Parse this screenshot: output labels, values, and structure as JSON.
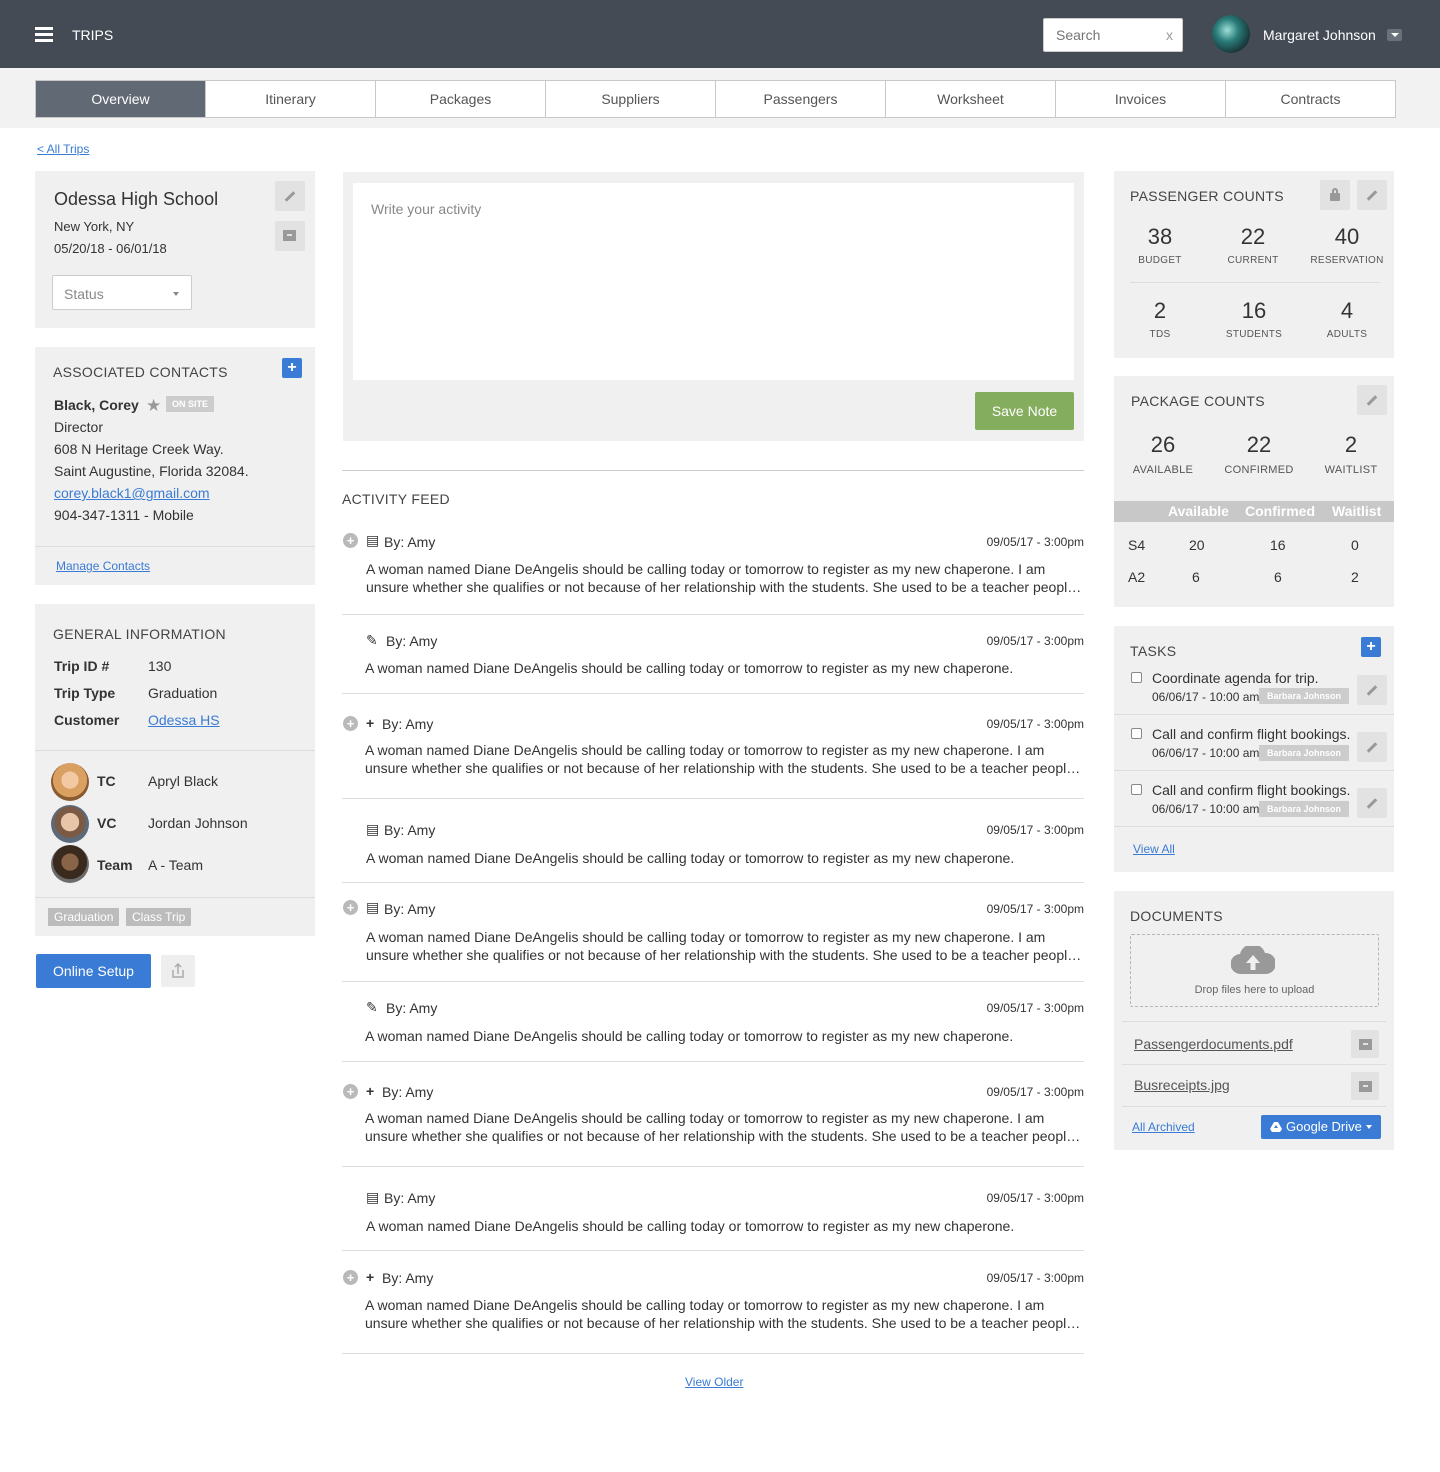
{
  "topbar": {
    "title": "TRIPS",
    "search_placeholder": "Search",
    "search_clear": "x",
    "user_name": "Margaret Johnson"
  },
  "tabs": [
    "Overview",
    "Itinerary",
    "Packages",
    "Suppliers",
    "Passengers",
    "Worksheet",
    "Invoices",
    "Contracts"
  ],
  "back_link": "< All Trips",
  "trip": {
    "name": "Odessa High School",
    "location": "New York, NY",
    "dates": "05/20/18 - 06/01/18",
    "status_placeholder": "Status"
  },
  "contacts": {
    "title": "ASSOCIATED CONTACTS",
    "add": "+",
    "name": "Black, Corey",
    "badge": "ON SITE",
    "role": "Director",
    "address1": "608 N Heritage Creek Way.",
    "address2": "Saint Augustine, Florida 32084.",
    "email": "corey.black1@gmail.com",
    "phone": "904-347-1311 - Mobile",
    "manage": "Manage Contacts"
  },
  "general": {
    "title": "GENERAL INFORMATION",
    "rows": [
      {
        "label": "Trip ID #",
        "value": "130"
      },
      {
        "label": "Trip Type",
        "value": "Graduation"
      },
      {
        "label": "Customer",
        "value": "Odessa HS"
      }
    ],
    "people": [
      {
        "role": "TC",
        "name": "Apryl Black"
      },
      {
        "role": "VC",
        "name": "Jordan Johnson"
      },
      {
        "role": "Team",
        "name": "A - Team"
      }
    ],
    "tags": [
      "Graduation",
      "Class Trip"
    ]
  },
  "online_setup": "Online Setup",
  "note": {
    "placeholder": "Write your activity",
    "save": "Save Note"
  },
  "feed": {
    "title": "ACTIVITY FEED",
    "items": [
      {
        "by": "By: Amy",
        "date": "09/05/17  -  3:00pm",
        "line1": "A woman named Diane DeAngelis should be calling today or tomorrow to register as my new chaperone. I am",
        "line2": "unsure whether she qualifies or not because of her relationship with the students. She used to be a teacher people at school"
      },
      {
        "by": "By: Amy",
        "date": "09/05/17  -  3:00pm",
        "line1": "A woman named Diane DeAngelis should be calling today or tomorrow to register as my new chaperone.",
        "line2": ""
      },
      {
        "by": "By: Amy",
        "date": "09/05/17  -  3:00pm",
        "line1": "A woman named Diane DeAngelis should be calling today or tomorrow to register as my new chaperone. I am",
        "line2": "unsure whether she qualifies or not because of her relationship with the students. She used to be a teacher people at school"
      },
      {
        "by": "By: Amy",
        "date": "09/05/17  -  3:00pm",
        "line1": "A woman named Diane DeAngelis should be calling today or tomorrow to register as my new chaperone.",
        "line2": ""
      },
      {
        "by": "By: Amy",
        "date": "09/05/17  -  3:00pm",
        "line1": "A woman named Diane DeAngelis should be calling today or tomorrow to register as my new chaperone. I am",
        "line2": "unsure whether she qualifies or not because of her relationship with the students. She used to be a teacher people at school"
      },
      {
        "by": "By: Amy",
        "date": "09/05/17  -  3:00pm",
        "line1": "A woman named Diane DeAngelis should be calling today or tomorrow to register as my new chaperone.",
        "line2": ""
      },
      {
        "by": "By: Amy",
        "date": "09/05/17  -  3:00pm",
        "line1": "A woman named Diane DeAngelis should be calling today or tomorrow to register as my new chaperone. I am",
        "line2": "unsure whether she qualifies or not because of her relationship with the students. She used to be a teacher people at school"
      },
      {
        "by": "By: Amy",
        "date": "09/05/17  -  3:00pm",
        "line1": "A woman named Diane DeAngelis should be calling today or tomorrow to register as my new chaperone.",
        "line2": ""
      },
      {
        "by": "By: Amy",
        "date": "09/05/17  -  3:00pm",
        "line1": "A woman named Diane DeAngelis should be calling today or tomorrow to register as my new chaperone. I am",
        "line2": "unsure whether she qualifies or not because of her relationship with the students. She used to be a teacher people at school"
      }
    ],
    "view_older": "View Older"
  },
  "passenger_counts": {
    "title": "PASSENGER COUNTS",
    "stats": [
      {
        "value": "38",
        "label": "BUDGET"
      },
      {
        "value": "22",
        "label": "CURRENT"
      },
      {
        "value": "40",
        "label": "RESERVATION"
      },
      {
        "value": "2",
        "label": "TDS"
      },
      {
        "value": "16",
        "label": "STUDENTS"
      },
      {
        "value": "4",
        "label": "ADULTS"
      }
    ]
  },
  "package_counts": {
    "title": "PACKAGE COUNTS",
    "stats": [
      {
        "value": "26",
        "label": "AVAILABLE"
      },
      {
        "value": "22",
        "label": "CONFIRMED"
      },
      {
        "value": "2",
        "label": "WAITLIST"
      }
    ],
    "headers": [
      "Available",
      "Confirmed",
      "Waitlist"
    ],
    "rows": [
      {
        "name": "S4",
        "available": "20",
        "confirmed": "16",
        "waitlist": "0"
      },
      {
        "name": "A2",
        "available": "6",
        "confirmed": "6",
        "waitlist": "2"
      }
    ]
  },
  "tasks": {
    "title": "TASKS",
    "add": "+",
    "items": [
      {
        "title": "Coordinate agenda for trip.",
        "date": "06/06/17 - 10:00 am",
        "assignee": "Barbara Johnson"
      },
      {
        "title": "Call and confirm flight bookings.",
        "date": "06/06/17 - 10:00 am",
        "assignee": "Barbara Johnson"
      },
      {
        "title": "Call and confirm flight bookings.",
        "date": "06/06/17 - 10:00 am",
        "assignee": "Barbara Johnson"
      }
    ],
    "view_all": "View All"
  },
  "documents": {
    "title": "DOCUMENTS",
    "drop": "Drop files here to upload",
    "files": [
      "Passengerdocuments.pdf",
      "Busreceipts.jpg"
    ],
    "all_archived": "All Archived",
    "gdrive": "Google Drive"
  },
  "colors": {
    "topbar": "#444b55",
    "accent_blue": "#3a7bd5",
    "save_green": "#84ad5e",
    "panel_bg": "#f0f0f0"
  }
}
